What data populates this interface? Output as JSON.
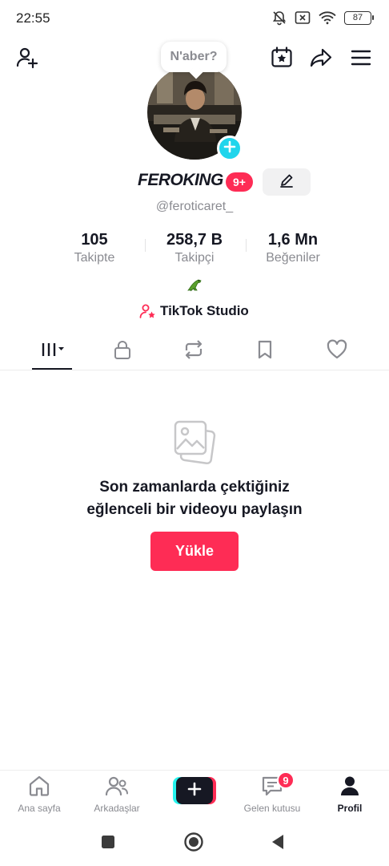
{
  "status_bar": {
    "time": "22:55",
    "battery": "87",
    "icons": [
      "mute-bell-icon",
      "no-sim-icon",
      "wifi-icon",
      "battery-icon"
    ]
  },
  "top_bar": {
    "icons": [
      "add-friend-icon",
      "calendar-star-icon",
      "share-icon",
      "menu-icon"
    ],
    "bubble_text": "N'aber?"
  },
  "profile": {
    "username": "FEROKING",
    "notification_badge": "9+",
    "handle": "@feroticaret_",
    "bio_emoji": "🐊",
    "studio_label": "TikTok Studio"
  },
  "stats": [
    {
      "value": "105",
      "label": "Takipte"
    },
    {
      "value": "258,7 B",
      "label": "Takipçi"
    },
    {
      "value": "1,6 Mn",
      "label": "Beğeniler"
    }
  ],
  "tabs": [
    "videos-grid-icon",
    "lock-icon",
    "repost-icon",
    "bookmark-icon",
    "heart-icon"
  ],
  "empty_state": {
    "line1": "Son zamanlarda çektiğiniz",
    "line2": "eğlenceli bir videoyu paylaşın",
    "button": "Yükle"
  },
  "bottom_nav": {
    "home": "Ana sayfa",
    "friends": "Arkadaşlar",
    "inbox": "Gelen kutusu",
    "inbox_badge": "9",
    "profile": "Profil"
  },
  "colors": {
    "accent": "#fe2c55",
    "cyan": "#25f4ee",
    "text": "#161823",
    "muted": "#8a8b91"
  }
}
